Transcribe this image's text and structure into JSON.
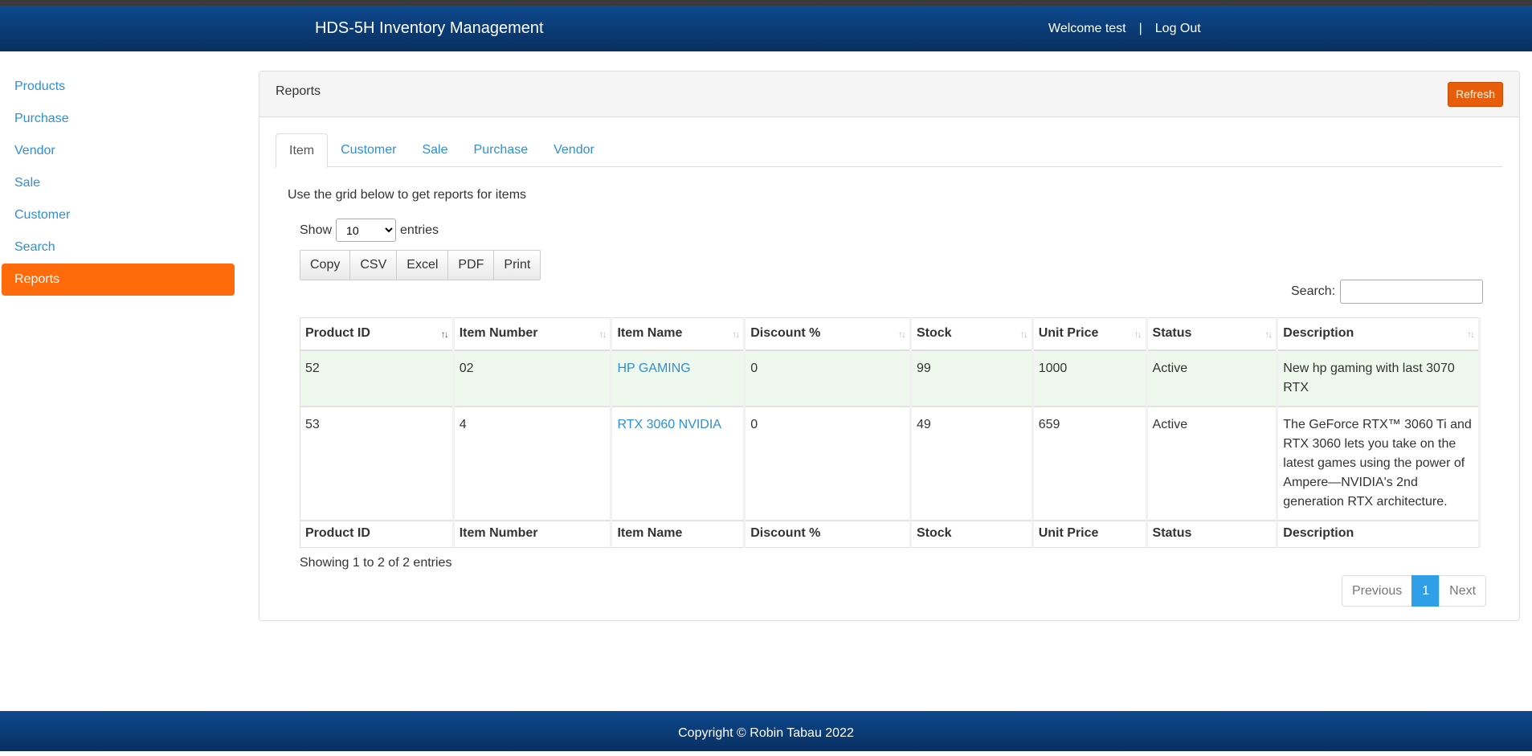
{
  "header": {
    "brand": "HDS-5H Inventory Management",
    "welcome": "Welcome test",
    "separator": "|",
    "logout": "Log Out"
  },
  "sidebar": {
    "items": [
      {
        "label": "Products"
      },
      {
        "label": "Purchase"
      },
      {
        "label": "Vendor"
      },
      {
        "label": "Sale"
      },
      {
        "label": "Customer"
      },
      {
        "label": "Search"
      },
      {
        "label": "Reports",
        "active": true
      }
    ]
  },
  "panel": {
    "title": "Reports",
    "refresh_label": "Refresh"
  },
  "tabs": [
    {
      "label": "Item",
      "active": true
    },
    {
      "label": "Customer"
    },
    {
      "label": "Sale"
    },
    {
      "label": "Purchase"
    },
    {
      "label": "Vendor"
    }
  ],
  "intro_text": "Use the grid below to get reports for items",
  "length": {
    "show_label": "Show",
    "selected": "10",
    "entries_label": "entries"
  },
  "export_buttons": [
    "Copy",
    "CSV",
    "Excel",
    "PDF",
    "Print"
  ],
  "search": {
    "label": "Search:",
    "value": ""
  },
  "table": {
    "columns": [
      "Product ID",
      "Item Number",
      "Item Name",
      "Discount %",
      "Stock",
      "Unit Price",
      "Status",
      "Description"
    ],
    "rows": [
      [
        "52",
        "02",
        "HP GAMING",
        "0",
        "99",
        "1000",
        "Active",
        "New hp gaming with last 3070 RTX"
      ],
      [
        "53",
        "4",
        "RTX 3060 NVIDIA",
        "0",
        "49",
        "659",
        "Active",
        "The GeForce RTX™ 3060 Ti and RTX 3060 lets you take on the latest games using the power of Ampere—NVIDIA's 2nd generation RTX architecture."
      ]
    ]
  },
  "info_text": "Showing 1 to 2 of 2 entries",
  "pagination": {
    "previous": "Previous",
    "current": "1",
    "next": "Next"
  },
  "footer": {
    "copyright": "Copyright © Robin Tabau 2022"
  },
  "colors": {
    "navbar": "#0a3a73",
    "active_sidebar": "#ff6a0a",
    "refresh_button": "#e85d0a",
    "link": "#2f8fd6",
    "pager_active": "#2f9fe8",
    "row_highlight": "#eef8ec"
  }
}
